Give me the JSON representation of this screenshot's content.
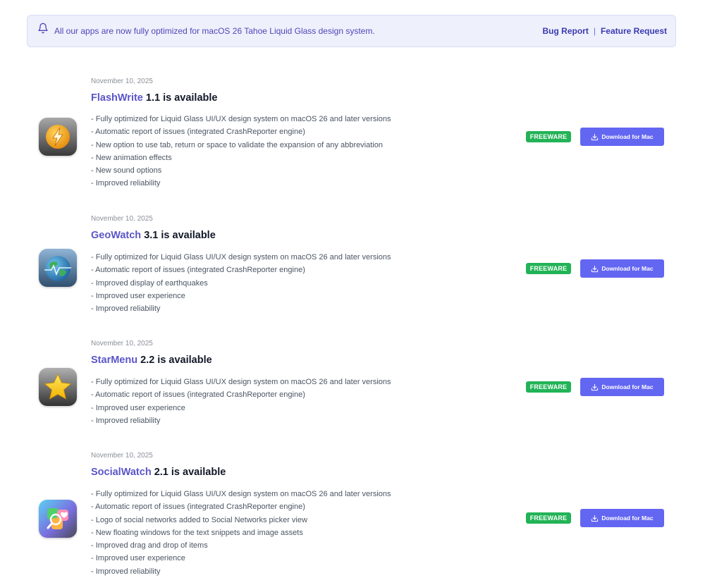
{
  "banner": {
    "icon": "bell-icon",
    "message": "All our apps are now fully optimized for macOS 26 Tahoe Liquid Glass design system.",
    "bug_report": "Bug Report",
    "separator": "|",
    "feature_request": "Feature Request"
  },
  "releases": [
    {
      "date": "November 10, 2025",
      "app": "FlashWrite",
      "version_text": " 1.1 is available",
      "icon": "flashwrite-app-icon",
      "badge": "FREEWARE",
      "download": "Download for Mac",
      "notes": [
        "- Fully optimized for Liquid Glass UI/UX design system on macOS 26 and later versions",
        "- Automatic report of issues (integrated CrashReporter engine)",
        "- New option to use tab, return or space to validate the expansion of any abbreviation",
        "- New animation effects",
        "- New sound options",
        "- Improved reliability"
      ]
    },
    {
      "date": "November 10, 2025",
      "app": "GeoWatch",
      "version_text": " 3.1 is available",
      "icon": "geowatch-app-icon",
      "badge": "FREEWARE",
      "download": "Download for Mac",
      "notes": [
        "- Fully optimized for Liquid Glass UI/UX design system on macOS 26 and later versions",
        "- Automatic report of issues (integrated CrashReporter engine)",
        "- Improved display of earthquakes",
        "- Improved user experience",
        "- Improved reliability"
      ]
    },
    {
      "date": "November 10, 2025",
      "app": "StarMenu",
      "version_text": " 2.2 is available",
      "icon": "starmenu-app-icon",
      "badge": "FREEWARE",
      "download": "Download for Mac",
      "notes": [
        "- Fully optimized for Liquid Glass UI/UX design system on macOS 26 and later versions",
        "- Automatic report of issues (integrated CrashReporter engine)",
        "- Improved user experience",
        "- Improved reliability"
      ]
    },
    {
      "date": "November 10, 2025",
      "app": "SocialWatch",
      "version_text": " 2.1 is available",
      "icon": "socialwatch-app-icon",
      "badge": "FREEWARE",
      "download": "Download for Mac",
      "notes": [
        "- Fully optimized for Liquid Glass UI/UX design system on macOS 26 and later versions",
        "- Automatic report of issues (integrated CrashReporter engine)",
        "- Logo of social networks added to Social Networks picker view",
        "- New floating windows for the text snippets and image assets",
        "- Improved drag and drop of items",
        "- Improved user experience",
        "- Improved reliability"
      ]
    }
  ],
  "colors": {
    "accent": "#6366f1",
    "app_name": "#5b55c9",
    "freeware_badge": "#22b357",
    "banner_bg": "#eef0fc"
  }
}
